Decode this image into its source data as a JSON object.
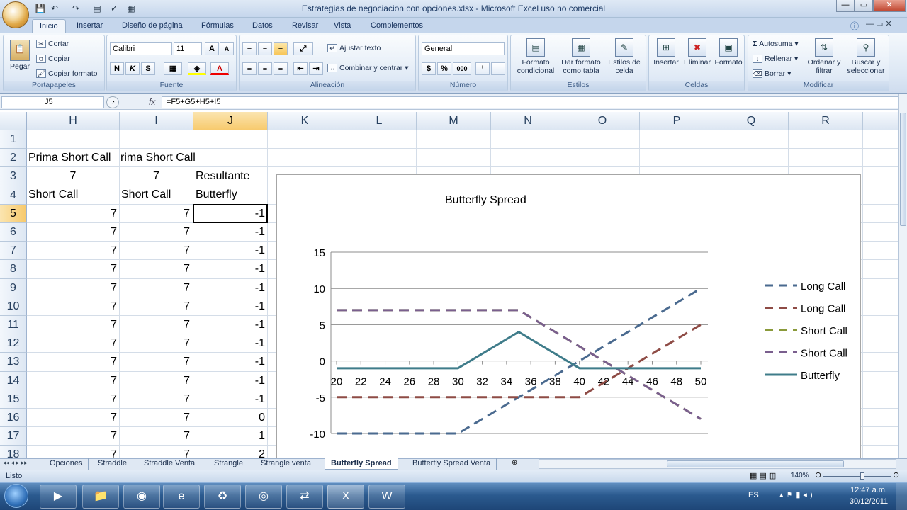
{
  "window": {
    "title": "Estrategias de negociacion con opciones.xlsx - Microsoft Excel uso no comercial",
    "minimize": "—",
    "maximize": "▭",
    "close": "✕"
  },
  "ribbon_tabs": [
    "Inicio",
    "Insertar",
    "Diseño de página",
    "Fórmulas",
    "Datos",
    "Revisar",
    "Vista",
    "Complementos"
  ],
  "ribbon": {
    "clipboard": {
      "paste": "Pegar",
      "cut": "Cortar",
      "copy": "Copiar",
      "format_painter": "Copiar formato",
      "label": "Portapapeles"
    },
    "font": {
      "name": "Calibri",
      "size": "11",
      "bold": "N",
      "italic": "K",
      "underline": "S",
      "label": "Fuente"
    },
    "alignment": {
      "wrap": "Ajustar texto",
      "merge": "Combinar y centrar",
      "label": "Alineación"
    },
    "number": {
      "format": "General",
      "currency": "$",
      "percent": "%",
      "thousands": "000",
      "label": "Número"
    },
    "styles": {
      "conditional": "Formato condicional",
      "table": "Dar formato como tabla",
      "cell_styles": "Estilos de celda",
      "label": "Estilos"
    },
    "cells": {
      "insert": "Insertar",
      "delete": "Eliminar",
      "format": "Formato",
      "label": "Celdas"
    },
    "editing": {
      "autosum": "Autosuma",
      "fill": "Rellenar",
      "clear": "Borrar",
      "sort": "Ordenar y filtrar",
      "find": "Buscar y seleccionar",
      "label": "Modificar"
    }
  },
  "formula_bar": {
    "name_box": "J5",
    "fx": "fx",
    "formula": "=F5+G5+H5+I5"
  },
  "columns": [
    "H",
    "I",
    "J",
    "K",
    "L",
    "M",
    "N",
    "O",
    "P",
    "Q",
    "R"
  ],
  "rows": [
    "1",
    "2",
    "3",
    "4",
    "5",
    "6",
    "7",
    "8",
    "9",
    "10",
    "11",
    "12",
    "13",
    "14",
    "15",
    "16",
    "17",
    "18"
  ],
  "cells": {
    "r2": {
      "H": "Prima Short Call",
      "I": "rima Short Call"
    },
    "r3": {
      "H": "7",
      "I": "7",
      "J": "Resultante"
    },
    "r4": {
      "H": "Short Call",
      "I": "Short Call",
      "J": "Butterfly"
    },
    "data": [
      [
        "7",
        "7",
        "-1"
      ],
      [
        "7",
        "7",
        "-1"
      ],
      [
        "7",
        "7",
        "-1"
      ],
      [
        "7",
        "7",
        "-1"
      ],
      [
        "7",
        "7",
        "-1"
      ],
      [
        "7",
        "7",
        "-1"
      ],
      [
        "7",
        "7",
        "-1"
      ],
      [
        "7",
        "7",
        "-1"
      ],
      [
        "7",
        "7",
        "-1"
      ],
      [
        "7",
        "7",
        "-1"
      ],
      [
        "7",
        "7",
        "-1"
      ],
      [
        "7",
        "7",
        "0"
      ],
      [
        "7",
        "7",
        "1"
      ],
      [
        "7",
        "7",
        "2"
      ]
    ]
  },
  "chart_data": {
    "type": "line",
    "title": "Butterfly Spread",
    "x": [
      20,
      22,
      24,
      26,
      28,
      30,
      32,
      34,
      35,
      36,
      38,
      40,
      42,
      44,
      46,
      48,
      50
    ],
    "xticks": [
      "20",
      "22",
      "24",
      "26",
      "28",
      "30",
      "32",
      "34",
      "36",
      "38",
      "40",
      "42",
      "44",
      "46",
      "48",
      "50"
    ],
    "yticks": [
      "15",
      "10",
      "5",
      "0",
      "-5",
      "-10"
    ],
    "ylim": [
      -10,
      15
    ],
    "xlim": [
      20,
      50
    ],
    "grid": true,
    "legend_position": "right",
    "series": [
      {
        "name": "Long Call",
        "color": "#4a6a8f",
        "dash": true,
        "points": [
          [
            20,
            -10
          ],
          [
            30,
            -10
          ],
          [
            50,
            10
          ]
        ]
      },
      {
        "name": "Long Call",
        "color": "#8e4b45",
        "dash": true,
        "points": [
          [
            20,
            -5
          ],
          [
            40,
            -5
          ],
          [
            50,
            5
          ]
        ]
      },
      {
        "name": "Short Call",
        "color": "#8a9a3a",
        "dash": true,
        "points": [
          [
            20,
            7
          ],
          [
            35,
            7
          ],
          [
            50,
            -8
          ]
        ]
      },
      {
        "name": "Short Call",
        "color": "#7a5f8e",
        "dash": true,
        "points": [
          [
            20,
            7
          ],
          [
            35,
            7
          ],
          [
            50,
            -8
          ]
        ]
      },
      {
        "name": "Butterfly",
        "color": "#3f7c8a",
        "dash": false,
        "points": [
          [
            20,
            -1
          ],
          [
            30,
            -1
          ],
          [
            35,
            4
          ],
          [
            40,
            -1
          ],
          [
            50,
            -1
          ]
        ]
      }
    ]
  },
  "sheet_tabs": [
    "Opciones",
    "Straddle",
    "Straddle Venta",
    "Strangle",
    "Strangle venta",
    "Butterfly Spread",
    "Butterfly Spread Venta"
  ],
  "active_sheet": "Butterfly Spread",
  "status": {
    "ready": "Listo",
    "zoom": "140%"
  },
  "taskbar": {
    "lang": "ES",
    "time": "12:47 a.m.",
    "date": "30/12/2011"
  }
}
